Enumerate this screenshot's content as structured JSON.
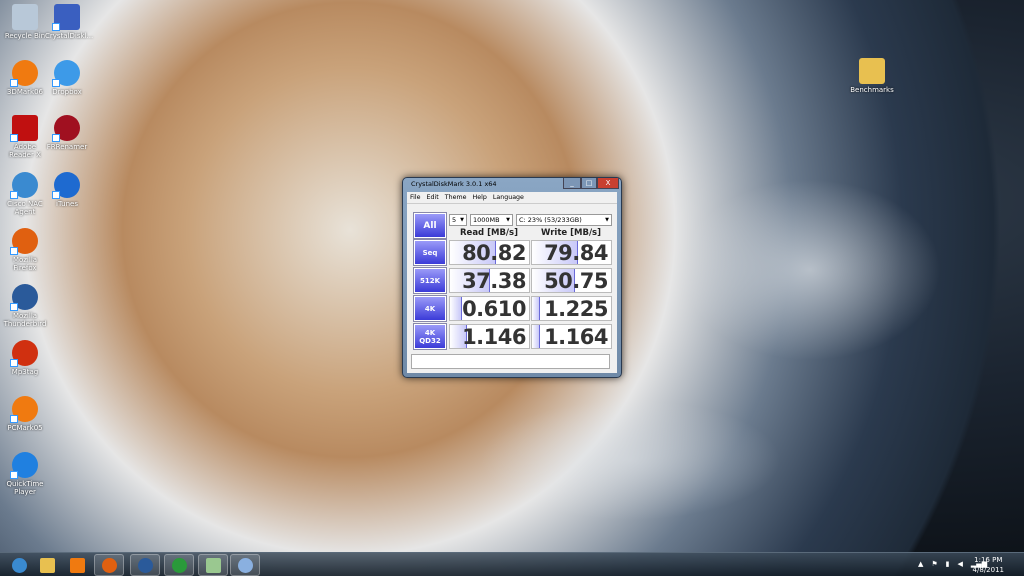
{
  "desktop": {
    "icons": [
      {
        "label": "Recycle Bin",
        "color": "#b8c8d8"
      },
      {
        "label": "CrystalDiskl...",
        "color": "#3a5fc0"
      },
      {
        "label": "3DMark06",
        "color": "#f07a10"
      },
      {
        "label": "Dropbox",
        "color": "#3d9ae8"
      },
      {
        "label": "Adobe Reader X",
        "color": "#c01010"
      },
      {
        "label": "FRRenamer",
        "color": "#a01020"
      },
      {
        "label": "Cisco NAC Agent",
        "color": "#3a8ad0"
      },
      {
        "label": "iTunes",
        "color": "#1e6ad0"
      },
      {
        "label": "Mozilla Firefox",
        "color": "#e06010"
      },
      {
        "label": "Mozilla Thunderbird",
        "color": "#2a5a9a"
      },
      {
        "label": "Mp3tag",
        "color": "#d03010"
      },
      {
        "label": "PCMark05",
        "color": "#f07a10"
      },
      {
        "label": "QuickTime Player",
        "color": "#2080e0"
      },
      {
        "label": "Benchmarks",
        "color": "#e8c050"
      }
    ]
  },
  "window": {
    "title": "CrystalDiskMark 3.0.1 x64",
    "minimize": "_",
    "maximize": "□",
    "close": "X",
    "menu": [
      "File",
      "Edit",
      "Theme",
      "Help",
      "Language"
    ],
    "all_button": "All",
    "runs": "5",
    "size": "1000MB",
    "drive": "C: 23% (53/233GB)",
    "read_header": "Read [MB/s]",
    "write_header": "Write [MB/s]",
    "rows": [
      {
        "label": "Seq",
        "read": "80.82",
        "write": "79.84",
        "read_fill": 0.58,
        "write_fill": 0.58
      },
      {
        "label": "512K",
        "read": "37.38",
        "write": "50.75",
        "read_fill": 0.51,
        "write_fill": 0.54
      },
      {
        "label": "4K",
        "read": "0.610",
        "write": "1.225",
        "read_fill": 0.15,
        "write_fill": 0.1
      },
      {
        "label": "4K QD32",
        "read": "1.146",
        "write": "1.164",
        "read_fill": 0.21,
        "write_fill": 0.1
      }
    ],
    "status": ""
  },
  "taskbar": {
    "items": [
      {
        "name": "start",
        "color": "#3a8ad0"
      },
      {
        "name": "explorer",
        "color": "#e8c050"
      },
      {
        "name": "media-player",
        "color": "#f07a10"
      },
      {
        "name": "firefox",
        "color": "#e06010"
      },
      {
        "name": "thunderbird",
        "color": "#2a5a9a"
      },
      {
        "name": "utorrent",
        "color": "#2a9a3a"
      },
      {
        "name": "crystaldiskmark",
        "color": "#9ac890"
      },
      {
        "name": "paint",
        "color": "#8ab0e0"
      }
    ],
    "time": "1:16 PM",
    "date": "4/8/2011"
  }
}
